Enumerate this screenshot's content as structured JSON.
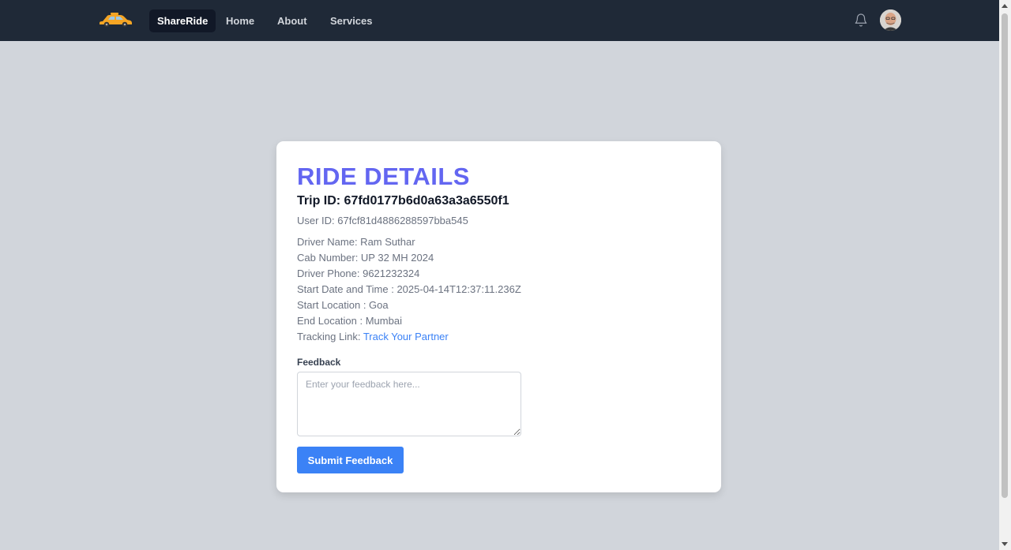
{
  "nav": {
    "logo": "cab-logo-icon",
    "items": [
      {
        "label": "ShareRide",
        "active": true
      },
      {
        "label": "Home",
        "active": false
      },
      {
        "label": "About",
        "active": false
      },
      {
        "label": "Services",
        "active": false
      }
    ],
    "notification_icon": "bell-icon",
    "avatar": "user-avatar"
  },
  "ride": {
    "heading": "RIDE DETAILS",
    "trip_id": "Trip ID: 67fd0177b6d0a63a3a6550f1",
    "user_id": "User ID: 67fcf81d4886288597bba545",
    "driver_name": "Driver Name: Ram Suthar",
    "cab_number": "Cab Number: UP 32 MH 2024",
    "driver_phone": "Driver Phone: 9621232324",
    "start_datetime": "Start Date and Time : 2025-04-14T12:37:11.236Z",
    "start_location": "Start Location : Goa",
    "end_location": "End Location : Mumbai",
    "tracking_label": "Tracking Link:",
    "tracking_link_text": "Track Your Partner"
  },
  "feedback": {
    "label": "Feedback",
    "placeholder": "Enter your feedback here...",
    "value": "",
    "submit_label": "Submit Feedback"
  },
  "colors": {
    "navbar": "#1f2937",
    "background": "#d1d5db",
    "heading": "#6366f1",
    "link": "#3b82f6",
    "button": "#3b82f6"
  }
}
